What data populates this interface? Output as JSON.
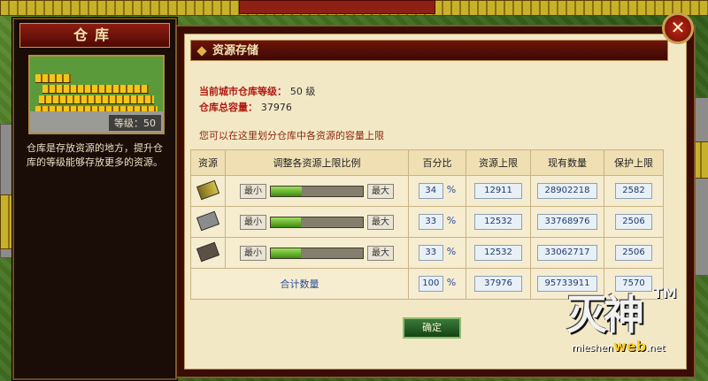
{
  "left_panel": {
    "title": "仓库",
    "level_text": "等级：50",
    "description": "仓库是存放资源的地方，提升仓库的等级能够存放更多的资源。"
  },
  "dialog": {
    "header": "资源存储",
    "close_glyph": "✕",
    "city_level_label": "当前城市仓库等级：",
    "city_level_value": "50 级",
    "capacity_label": "仓库总容量：",
    "capacity_value": "37976",
    "hint": "您可以在这里划分仓库中各资源的容量上限",
    "confirm_label": "确定"
  },
  "table": {
    "headers": [
      "资源",
      "调整各资源上限比例",
      "百分比",
      "资源上限",
      "现有数量",
      "保护上限"
    ],
    "min_label": "最小",
    "max_label": "最大",
    "pct_sign": "%",
    "rows": [
      {
        "icon": "wood-icon",
        "percent": "34",
        "fill": 0.34,
        "limit": "12911",
        "current": "28902218",
        "protect": "2582"
      },
      {
        "icon": "stone-icon",
        "percent": "33",
        "fill": 0.33,
        "limit": "12532",
        "current": "33768976",
        "protect": "2506"
      },
      {
        "icon": "iron-icon",
        "percent": "33",
        "fill": 0.33,
        "limit": "12532",
        "current": "33062717",
        "protect": "2506"
      }
    ],
    "total": {
      "label": "合计数量",
      "percent": "100",
      "limit": "37976",
      "current": "95733911",
      "protect": "7570"
    }
  },
  "watermark": {
    "logo_text": "灭神",
    "tm": "TM",
    "site_pre": "mieshen",
    "site_web": "web",
    "site_post": ".net"
  },
  "colors": {
    "accent": "#b01a10",
    "panel": "#3a0c05",
    "parchment": "#f3e8c6",
    "fill": "#5fb22a"
  }
}
